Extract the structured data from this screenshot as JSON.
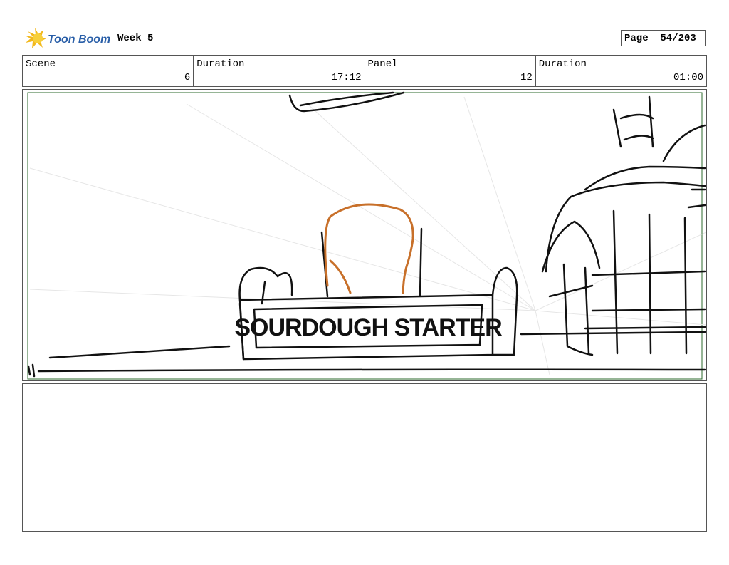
{
  "header": {
    "logo_text": "Toon Boom",
    "title": "Week 5",
    "page_label": "Page  54/203"
  },
  "info": [
    {
      "label": "Scene",
      "value": "6"
    },
    {
      "label": "Duration",
      "value": "17:12"
    },
    {
      "label": "Panel",
      "value": "12"
    },
    {
      "label": "Duration",
      "value": "01:00"
    }
  ],
  "panel": {
    "sign_text": "SOURDOUGH STARTER"
  },
  "colors": {
    "border": "#555555",
    "sketch": "#111111",
    "accent_stroke": "#c8702a",
    "frame_green": "#2e6b2e",
    "logo_yellow": "#f2b81c"
  }
}
